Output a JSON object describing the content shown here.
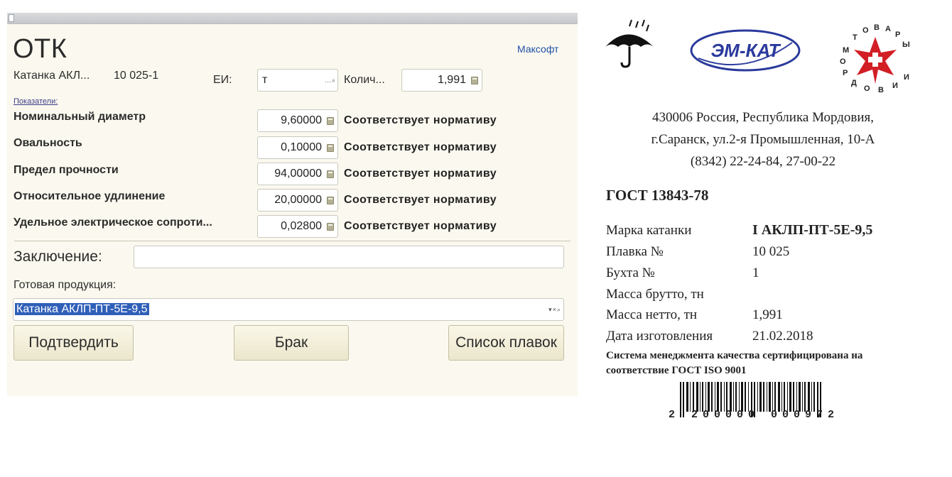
{
  "form": {
    "title": "ОТК",
    "vendor_link": "Максофт",
    "product_short": "Катанка АКЛ...",
    "batch_code": "10 025-1",
    "unit_label": "ЕИ:",
    "unit_value": "т",
    "qty_label": "Колич...",
    "qty_value": "1,991",
    "indicators_label": "Показатели:",
    "indicators": [
      {
        "name": "Номинальный диаметр",
        "value": "9,60000",
        "status": "Соответствует нормативу"
      },
      {
        "name": "Овальность",
        "value": "0,10000",
        "status": "Соответствует нормативу"
      },
      {
        "name": "Предел прочности",
        "value": "94,00000",
        "status": "Соответствует нормативу"
      },
      {
        "name": "Относительное удлинение",
        "value": "20,00000",
        "status": "Соответствует нормативу"
      },
      {
        "name": "Удельное электрическое сопроти...",
        "value": "0,02800",
        "status": "Соответствует нормативу"
      }
    ],
    "conclusion_label": "Заключение:",
    "conclusion_value": "",
    "finished_label": "Готовая продукция:",
    "finished_value": "Катанка АКЛП-ПТ-5Е-9,5",
    "buttons": {
      "confirm": "Подтвердить",
      "reject": "Брак",
      "batches": "Список плавок"
    }
  },
  "label": {
    "company_logo": "ЭМ-КАТ",
    "badge_ring_text": "ТОВАРЫ МОРДОВИИ",
    "address": [
      "430006 Россия, Республика Мордовия,",
      "г.Саранск, ул.2-я Промышленная, 10-А",
      "(8342) 22-24-84, 27-00-22"
    ],
    "gost": "ГОСТ 13843-78",
    "rows": [
      {
        "label": "Марка катанки",
        "value": "I АКЛП-ПТ-5Е-9,5"
      },
      {
        "label": "Плавка №",
        "value": "10 025"
      },
      {
        "label": "Бухта №",
        "value": "1"
      },
      {
        "label": "Масса брутто, тн",
        "value": ""
      },
      {
        "label": "Масса нетто, тн",
        "value": "1,991"
      },
      {
        "label": "Дата изготовления",
        "value": "21.02.2018"
      }
    ],
    "certification": [
      "Система менеджмента качества сертифицирована на",
      "соответствие ГОСТ ISO 9001"
    ],
    "barcode_digits": "2 200000 000972"
  },
  "colors": {
    "form_bg": "#fbf9ef",
    "link": "#1f4fa8",
    "selection": "#2f5fb8",
    "logo_blue": "#2a3a9c",
    "badge_red": "#d21f26"
  },
  "icons": [
    "umbrella-icon",
    "calculator-icon",
    "search-icon",
    "clear-icon",
    "dropdown-icon"
  ]
}
